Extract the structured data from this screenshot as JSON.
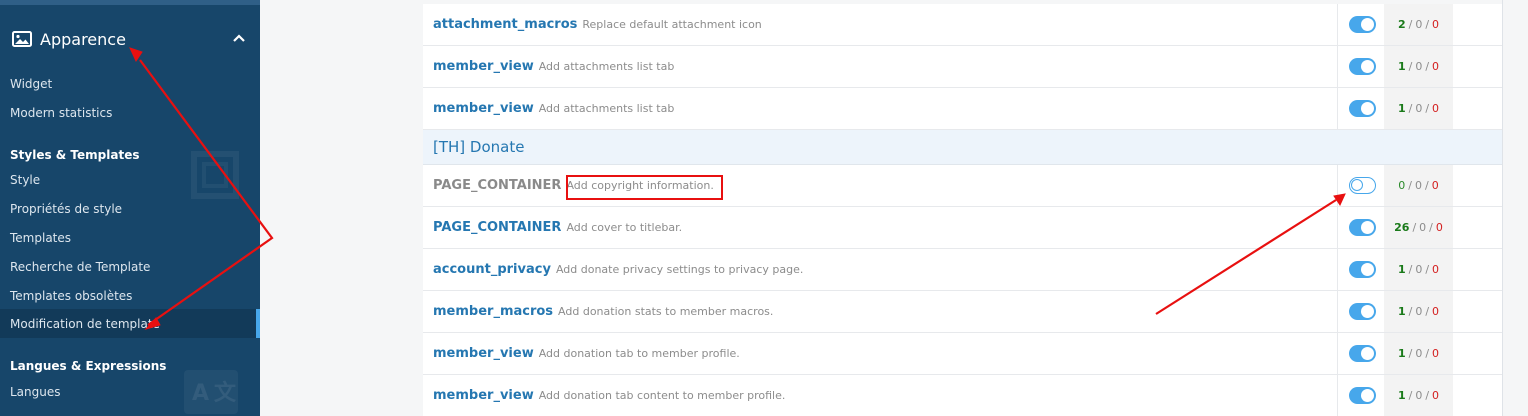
{
  "sidebar": {
    "section_title": "Apparence",
    "items_top": [
      {
        "label": "Widget"
      },
      {
        "label": "Modern statistics"
      }
    ],
    "group_styles": "Styles & Templates",
    "items_styles": [
      {
        "label": "Style"
      },
      {
        "label": "Propriétés de style"
      },
      {
        "label": "Templates"
      },
      {
        "label": "Recherche de Template"
      },
      {
        "label": "Templates obsolètes"
      },
      {
        "label": "Modification de template",
        "active": true
      }
    ],
    "group_langs": "Langues & Expressions",
    "items_langs": [
      {
        "label": "Langues"
      }
    ]
  },
  "table": {
    "rows_top": [
      {
        "name": "attachment_macros",
        "desc": "Replace default attachment icon",
        "enabled": true,
        "count_a": "2",
        "count_b": "0",
        "count_c": "0"
      },
      {
        "name": "member_view",
        "desc": "Add attachments list tab",
        "enabled": true,
        "count_a": "1",
        "count_b": "0",
        "count_c": "0"
      },
      {
        "name": "member_view",
        "desc": "Add attachments list tab",
        "enabled": true,
        "count_a": "1",
        "count_b": "0",
        "count_c": "0"
      }
    ],
    "group_title": "[TH] Donate",
    "rows_group": [
      {
        "name": "PAGE_CONTAINER",
        "desc": "Add copyright information.",
        "enabled": false,
        "count_a": "0",
        "count_b": "0",
        "count_c": "0"
      },
      {
        "name": "PAGE_CONTAINER",
        "desc": "Add cover to titlebar.",
        "enabled": true,
        "count_a": "26",
        "count_b": "0",
        "count_c": "0"
      },
      {
        "name": "account_privacy",
        "desc": "Add donate privacy settings to privacy page.",
        "enabled": true,
        "count_a": "1",
        "count_b": "0",
        "count_c": "0"
      },
      {
        "name": "member_macros",
        "desc": "Add donation stats to member macros.",
        "enabled": true,
        "count_a": "1",
        "count_b": "0",
        "count_c": "0"
      },
      {
        "name": "member_view",
        "desc": "Add donation tab to member profile.",
        "enabled": true,
        "count_a": "1",
        "count_b": "0",
        "count_c": "0"
      },
      {
        "name": "member_view",
        "desc": "Add donation tab content to member profile.",
        "enabled": true,
        "count_a": "1",
        "count_b": "0",
        "count_c": "0"
      }
    ],
    "count_separator": "/"
  },
  "colors": {
    "sidebar_bg": "#17466a",
    "accent": "#47a7eb",
    "link": "#2577b1",
    "annotation": "#e81010",
    "count_green": "#1a7a1a",
    "count_red": "#d42020"
  },
  "icons": {
    "section": "image-icon",
    "collapse": "chevron-up-icon",
    "toggle_on": "toggle-on-icon",
    "toggle_off": "toggle-off-icon"
  }
}
